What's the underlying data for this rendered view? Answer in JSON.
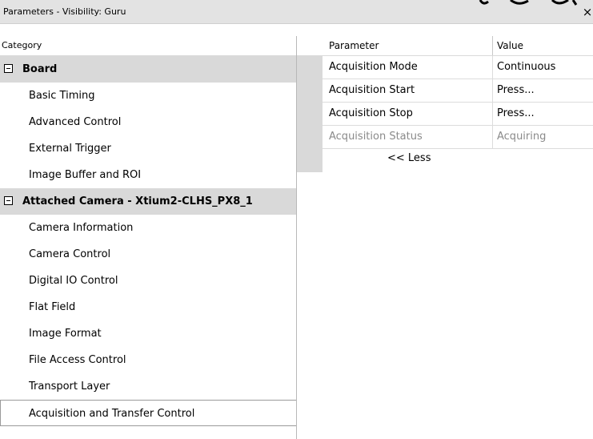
{
  "window": {
    "title": "Parameters - Visibility: Guru",
    "close_glyph": "×"
  },
  "category_panel": {
    "header": "Category",
    "groups": [
      {
        "label": "Board",
        "expander": "minus",
        "items": [
          {
            "label": "Basic Timing"
          },
          {
            "label": "Advanced Control"
          },
          {
            "label": "External Trigger"
          },
          {
            "label": "Image Buffer and ROI"
          }
        ]
      },
      {
        "label": "Attached Camera - Xtium2-CLHS_PX8_1",
        "expander": "minus",
        "items": [
          {
            "label": "Camera Information"
          },
          {
            "label": "Camera Control"
          },
          {
            "label": "Digital IO Control"
          },
          {
            "label": "Flat Field"
          },
          {
            "label": "Image Format"
          },
          {
            "label": "File Access Control"
          },
          {
            "label": "Transport Layer"
          },
          {
            "label": "Acquisition and Transfer Control",
            "selected": true
          }
        ]
      }
    ]
  },
  "parameter_grid": {
    "headers": {
      "parameter": "Parameter",
      "value": "Value"
    },
    "rows": [
      {
        "parameter": "Acquisition Mode",
        "value": "Continuous",
        "enabled": true
      },
      {
        "parameter": "Acquisition Start",
        "value": "Press...",
        "enabled": true
      },
      {
        "parameter": "Acquisition Stop",
        "value": "Press...",
        "enabled": true
      },
      {
        "parameter": "Acquisition Status",
        "value": "Acquiring",
        "enabled": false
      }
    ],
    "less_link": "<< Less"
  },
  "colors": {
    "group_row_bg": "#d9d9d9",
    "disabled_text": "#8a8a8a",
    "titlebar_bg": "#e3e3e3"
  }
}
